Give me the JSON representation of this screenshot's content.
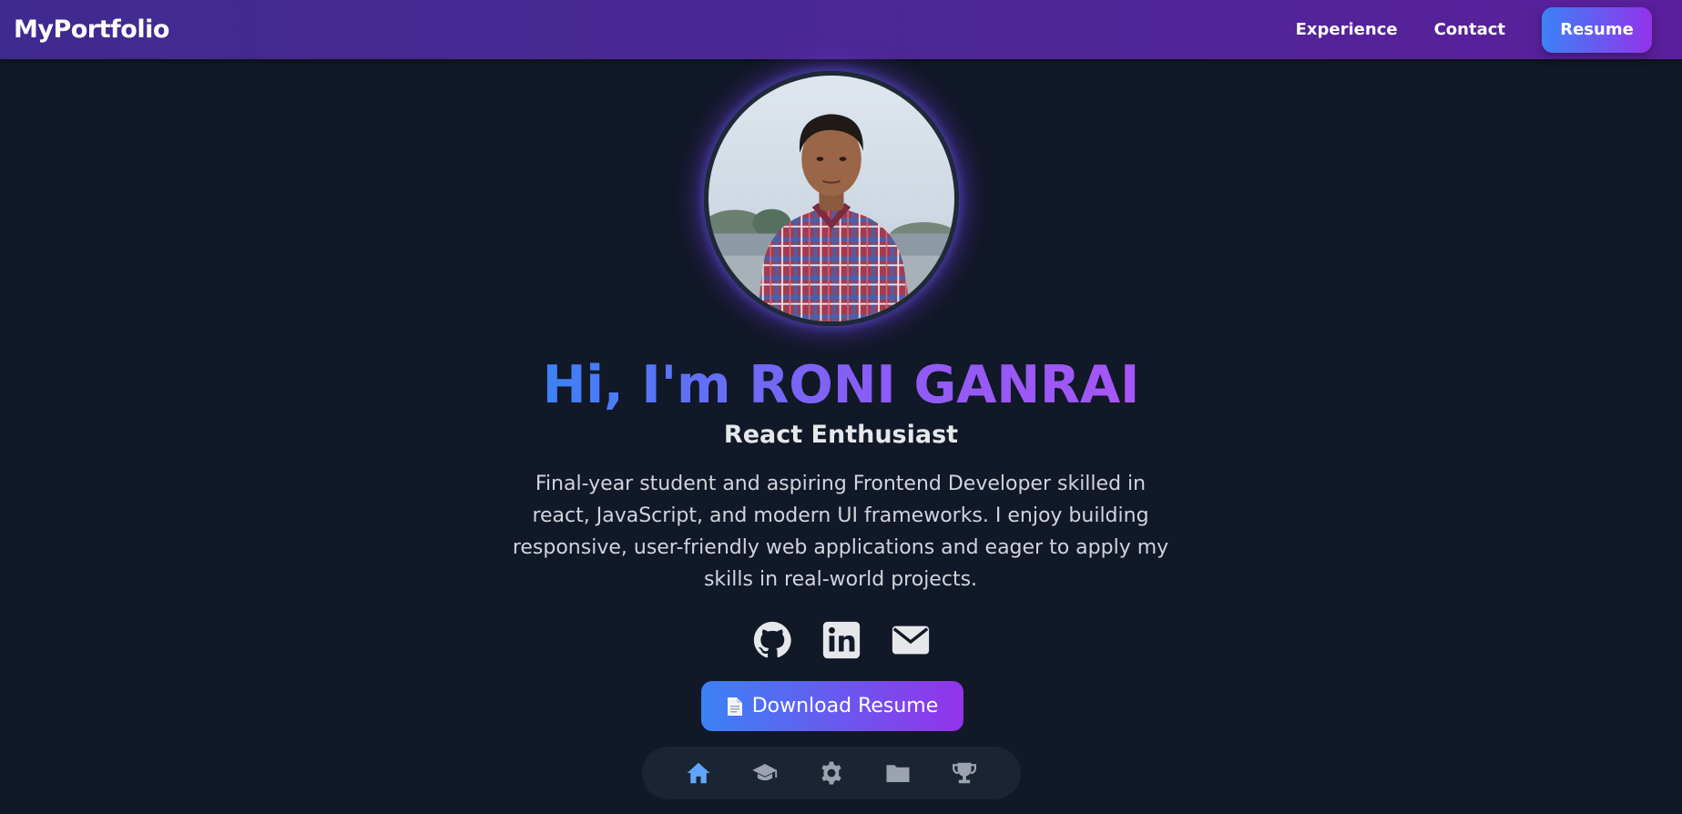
{
  "nav": {
    "brand": "MyPortfolio",
    "links": [
      "Experience",
      "Contact"
    ],
    "resume_label": "Resume"
  },
  "hero": {
    "title": "Hi, I'm RONI GANRAI",
    "subtitle": "React Enthusiast",
    "bio": "Final-year student and aspiring Frontend Developer skilled in react, JavaScript, and modern UI frameworks. I enjoy building responsive, user-friendly web applications and eager to apply my skills in real-world projects.",
    "download_label": "Download Resume"
  },
  "socials": [
    "github-icon",
    "linkedin-icon",
    "email-icon"
  ],
  "dock": {
    "items": [
      "home-icon",
      "graduation-cap-icon",
      "gear-icon",
      "folder-icon",
      "trophy-icon"
    ],
    "active": "home-icon"
  },
  "colors": {
    "background": "#111827",
    "nav_gradient_start": "#3f2a8f",
    "nav_gradient_end": "#5a1f9c",
    "accent_blue": "#3b82f6",
    "accent_purple": "#9333ea",
    "dock_bg": "#1b2433",
    "dock_active": "#60a5fa",
    "dock_inactive": "#9ca3af"
  }
}
